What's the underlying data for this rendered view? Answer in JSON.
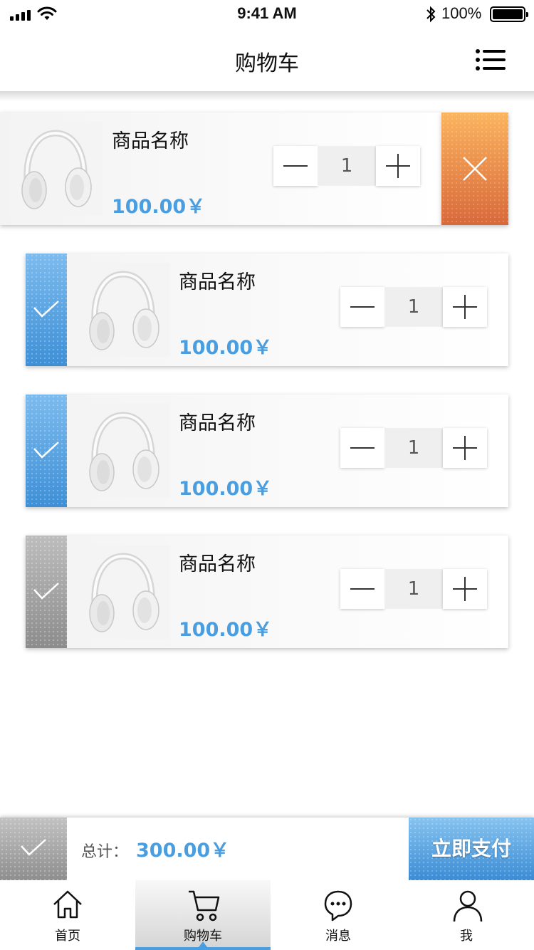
{
  "status_bar": {
    "time": "9:41 AM",
    "battery_percent": "100%",
    "icons": [
      "signal-icon",
      "wifi-icon",
      "bluetooth-icon",
      "battery-icon"
    ]
  },
  "navbar": {
    "title": "购物车",
    "menu_icon": "menu-icon"
  },
  "swiped_item": {
    "name": "商品名称",
    "price": "100.00￥",
    "quantity": "1",
    "delete_icon": "close-icon"
  },
  "cart_items": [
    {
      "name": "商品名称",
      "price": "100.00￥",
      "quantity": "1",
      "selected": true
    },
    {
      "name": "商品名称",
      "price": "100.00￥",
      "quantity": "1",
      "selected": true
    },
    {
      "name": "商品名称",
      "price": "100.00￥",
      "quantity": "1",
      "selected": false
    }
  ],
  "checkout": {
    "total_label": "总计：",
    "total_value": "300.00￥",
    "pay_label": "立即支付"
  },
  "tabbar": {
    "active_index": 1,
    "tabs": [
      {
        "label": "首页",
        "icon": "home-icon"
      },
      {
        "label": "购物车",
        "icon": "cart-icon"
      },
      {
        "label": "消息",
        "icon": "message-icon"
      },
      {
        "label": "我",
        "icon": "user-icon"
      }
    ]
  },
  "colors": {
    "accent_blue": "#4a9ee0",
    "delete_orange": "#e8874a",
    "unselected_gray": "#a0a0a0"
  }
}
